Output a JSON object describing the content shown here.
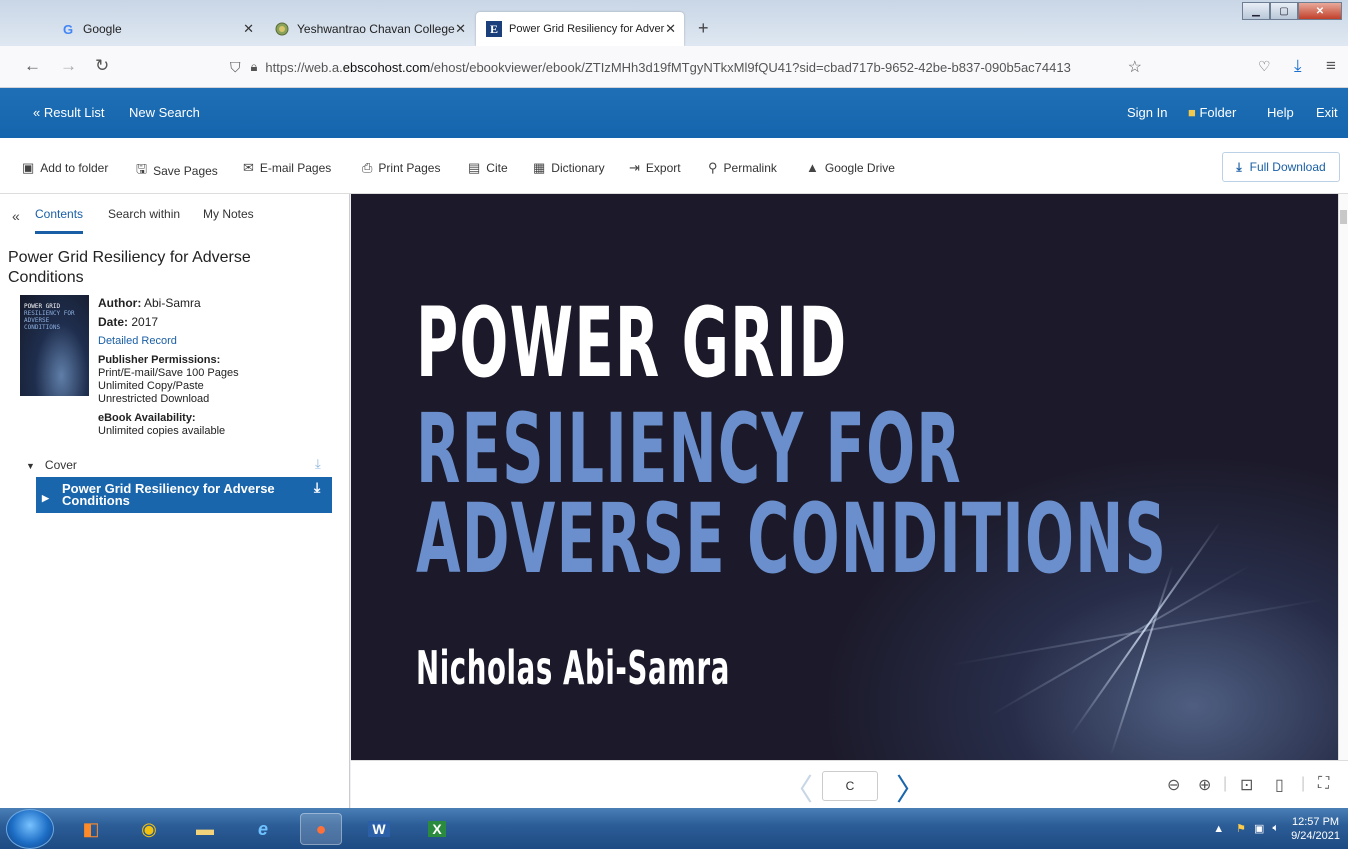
{
  "browser": {
    "tabs": [
      {
        "title": "Google",
        "favicon": "G"
      },
      {
        "title": "Yeshwantrao Chavan College of",
        "favicon": "college-logo"
      },
      {
        "title": "Power Grid Resiliency for Adver",
        "favicon": "E"
      }
    ],
    "new_tab": "+",
    "url_prefix": "https://web.a.",
    "url_host": "ebscohost.com",
    "url_rest": "/ehost/ebookviewer/ebook/ZTIzMHh3d19fMTgyNTkxMl9fQU41?sid=cbad717b-9652-42be-b837-090b5ac74413"
  },
  "ebsco_header": {
    "result_list": "« Result List",
    "new_search": "New Search",
    "sign_in": "Sign In",
    "folder": "Folder",
    "help": "Help",
    "exit": "Exit"
  },
  "toolbar": {
    "add_to_folder": "Add to folder",
    "save_pages": "Save Pages",
    "email_pages": "E-mail Pages",
    "print_pages": "Print Pages",
    "cite": "Cite",
    "dictionary": "Dictionary",
    "export": "Export",
    "permalink": "Permalink",
    "google_drive": "Google Drive",
    "full_download": "Full Download"
  },
  "sidebar": {
    "collapse": "«",
    "tabs": [
      "Contents",
      "Search within",
      "My Notes"
    ],
    "book_title": "Power Grid Resiliency for Adverse Conditions",
    "author_label": "Author:",
    "author": "Abi-Samra",
    "date_label": "Date:",
    "date": "2017",
    "detailed_record": "Detailed Record",
    "permissions_label": "Publisher Permissions:",
    "permissions": [
      "Print/E-mail/Save 100 Pages",
      "Unlimited Copy/Paste",
      "Unrestricted Download"
    ],
    "availability_label": "eBook Availability:",
    "availability": "Unlimited copies available",
    "toc_cover": "Cover",
    "toc_selected_line1": "Power Grid Resiliency for Adverse",
    "toc_selected_line2": "Conditions"
  },
  "cover": {
    "line1": "POWER GRID",
    "line2": "RESILIENCY FOR",
    "line3": "ADVERSE CONDITIONS",
    "author": "Nicholas Abi-Samra",
    "thumb_line1": "POWER GRID",
    "thumb_line2": "RESILIENCY FOR",
    "thumb_line3": "ADVERSE CONDITIONS"
  },
  "pager": {
    "page_value": "C"
  },
  "taskbar": {
    "time": "12:57 PM",
    "date": "9/24/2021"
  },
  "colors": {
    "ebsco_blue": "#1465ad",
    "cover_bg": "#1c1a2a",
    "cover_accent": "#6a8fcc"
  }
}
